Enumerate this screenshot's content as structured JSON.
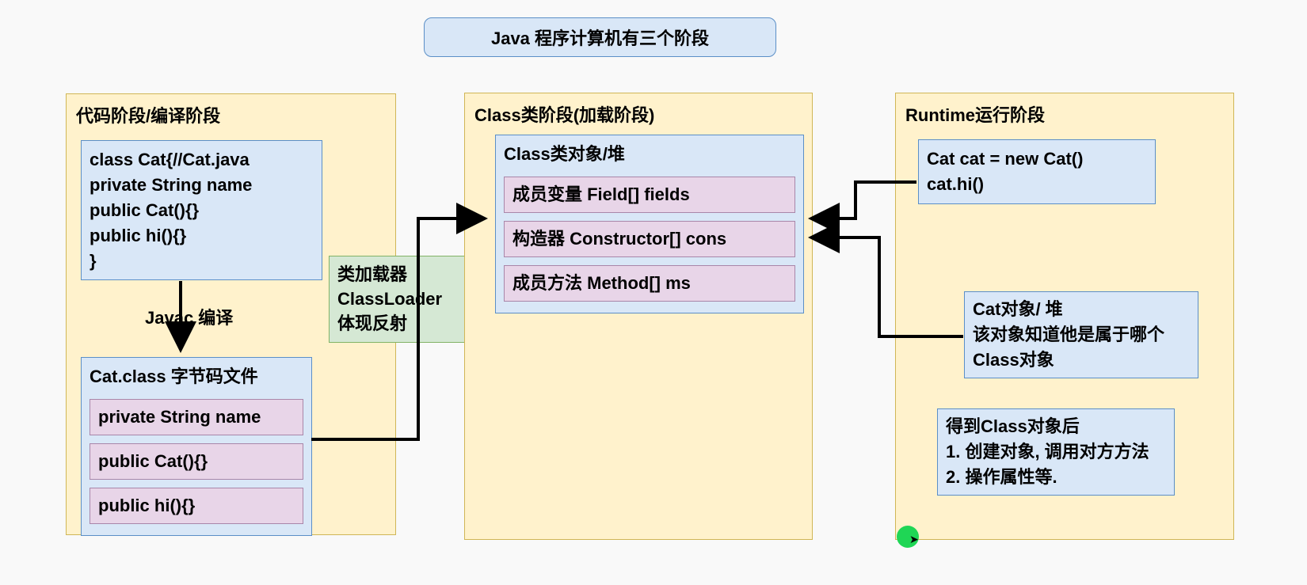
{
  "title": "Java 程序计算机有三个阶段",
  "stage1": {
    "title": "代码阶段/编译阶段",
    "code": "class Cat{//Cat.java\nprivate String name\npublic Cat(){}\npublic hi(){}\n}",
    "compile_label": "Javac 编译",
    "bytecode_title": "Cat.class 字节码文件",
    "bytecode_field": "private String name",
    "bytecode_constructor": "public Cat(){}",
    "bytecode_method": "public hi(){}"
  },
  "classloader": "类加载器\nClassLoader\n体现反射",
  "stage2": {
    "title": "Class类阶段(加载阶段)",
    "heap_title": "Class类对象/堆",
    "fields": "成员变量 Field[] fields",
    "constructors": "构造器 Constructor[] cons",
    "methods": "成员方法 Method[] ms"
  },
  "stage3": {
    "title": "Runtime运行阶段",
    "code": "Cat cat = new Cat()\ncat.hi()",
    "cat_obj": "Cat对象/ 堆\n该对象知道他是属于哪个Class对象",
    "summary": "得到Class对象后\n1. 创建对象, 调用对方方法 2. 操作属性等."
  }
}
